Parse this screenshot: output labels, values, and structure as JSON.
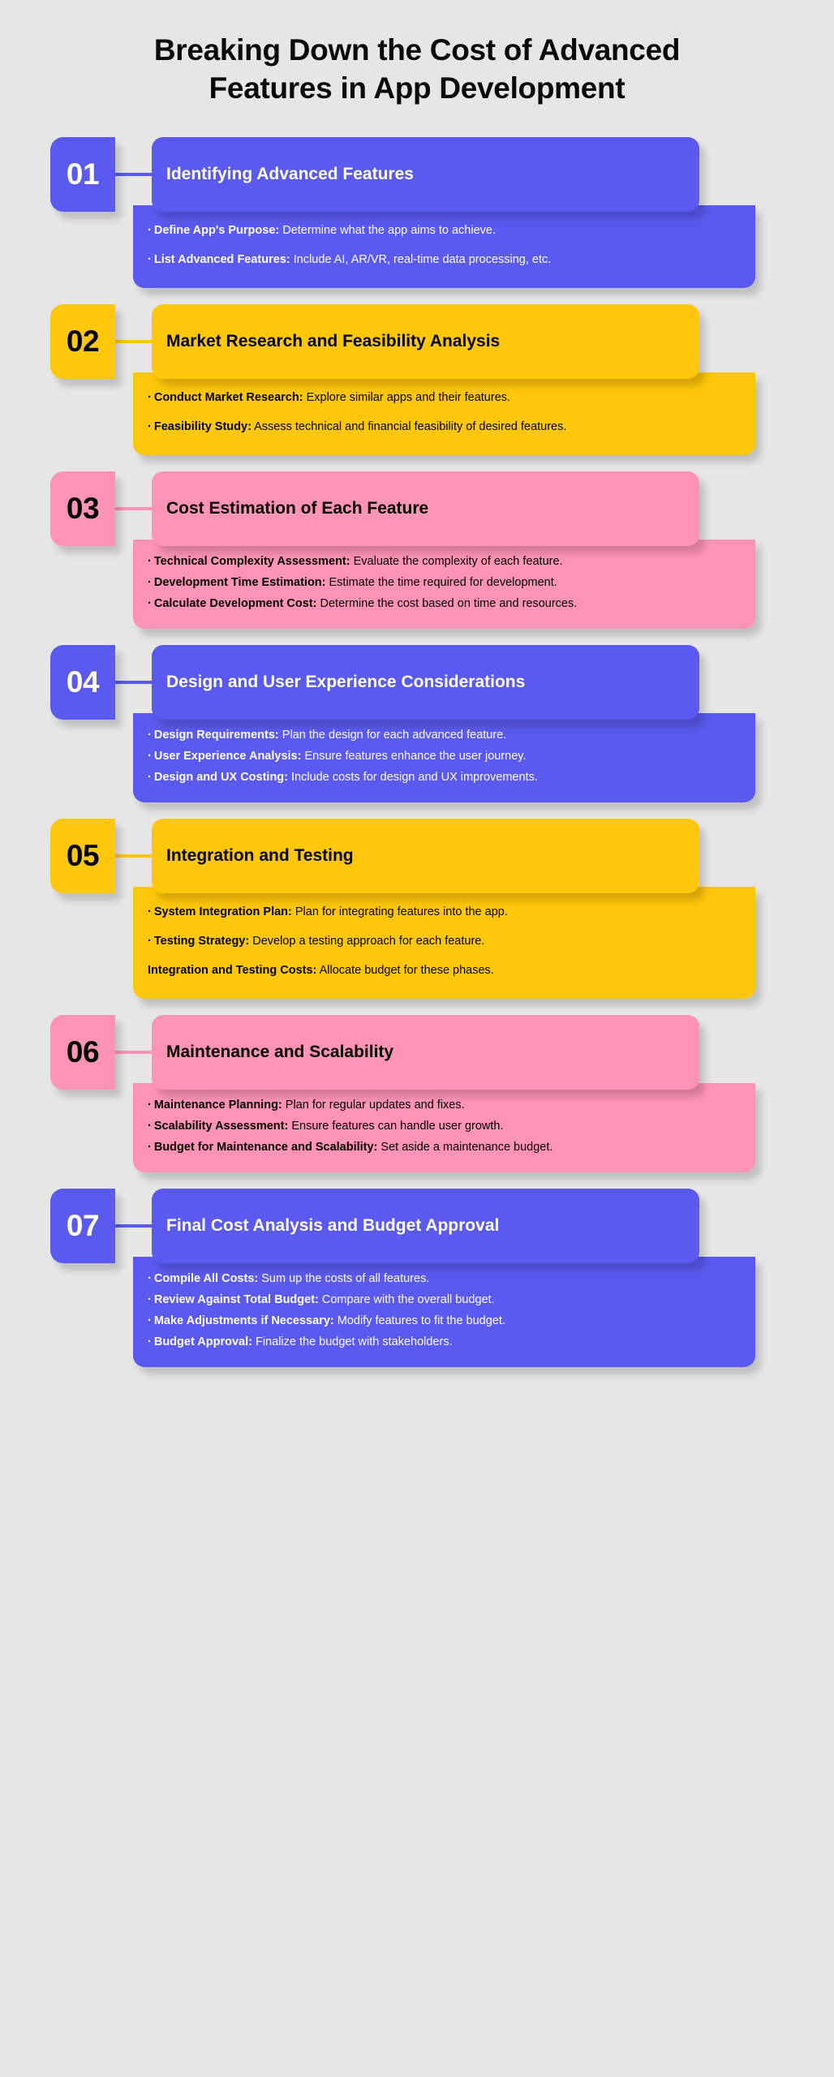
{
  "title": "Breaking Down the Cost of Advanced Features in App Development",
  "colors": {
    "background": "#e6e6e6",
    "blue": "#5a5af0",
    "yellow": "#ffc709",
    "pink": "#ff94b4",
    "title_text": "#0a0a0a"
  },
  "steps": [
    {
      "number": "01",
      "color": "blue",
      "heading": "Identifying Advanced Features",
      "bullets": [
        {
          "marker": "·",
          "lead": "Define App's Purpose:",
          "text": " Determine what the app aims to achieve."
        },
        {
          "marker": "·",
          "lead": "List Advanced Features:",
          "text": " Include AI, AR/VR, real-time data processing, etc."
        }
      ]
    },
    {
      "number": "02",
      "color": "yellow",
      "heading": "Market Research and Feasibility Analysis",
      "bullets": [
        {
          "marker": "·",
          "lead": "Conduct Market Research:",
          "text": " Explore similar apps and their features."
        },
        {
          "marker": "·",
          "lead": "Feasibility Study:",
          "text": " Assess technical and financial feasibility of desired features."
        }
      ]
    },
    {
      "number": "03",
      "color": "pink",
      "heading": "Cost Estimation of Each Feature",
      "compact": true,
      "bullets": [
        {
          "marker": "·",
          "lead": "Technical Complexity Assessment:",
          "text": " Evaluate the complexity of each feature."
        },
        {
          "marker": "·",
          "lead": "Development Time Estimation:",
          "text": " Estimate the time required for development."
        },
        {
          "marker": "·",
          "lead": "Calculate Development Cost:",
          "text": " Determine the cost based on time and resources."
        }
      ]
    },
    {
      "number": "04",
      "color": "blue",
      "heading": "Design and User Experience Considerations",
      "compact": true,
      "bullets": [
        {
          "marker": "·",
          "lead": "Design Requirements:",
          "text": " Plan the design for each advanced feature."
        },
        {
          "marker": "·",
          "lead": "User Experience Analysis:",
          "text": " Ensure features enhance the user journey."
        },
        {
          "marker": "·",
          "lead": "Design and UX Costing:",
          "text": " Include costs for design and UX improvements."
        }
      ]
    },
    {
      "number": "05",
      "color": "yellow",
      "heading": "Integration and Testing",
      "bullets": [
        {
          "marker": "·",
          "lead": "System Integration Plan:",
          "text": " Plan for integrating features into the app."
        },
        {
          "marker": "·",
          "lead": "Testing Strategy:",
          "text": " Develop a testing approach for each feature."
        },
        {
          "marker": "",
          "lead": "Integration and Testing Costs:",
          "text": " Allocate budget for these phases."
        }
      ]
    },
    {
      "number": "06",
      "color": "pink",
      "heading": "Maintenance and Scalability",
      "compact": true,
      "bullets": [
        {
          "marker": "·",
          "lead": "Maintenance Planning:",
          "text": " Plan for regular updates and fixes."
        },
        {
          "marker": "·",
          "lead": "Scalability Assessment:",
          "text": " Ensure features can handle user growth."
        },
        {
          "marker": "·",
          "lead": "Budget for Maintenance and Scalability:",
          "text": " Set aside a maintenance budget."
        }
      ]
    },
    {
      "number": "07",
      "color": "blue",
      "heading": "Final Cost Analysis and Budget Approval",
      "compact": true,
      "bullets": [
        {
          "marker": "·",
          "lead": "Compile All Costs:",
          "text": " Sum up the costs of all features."
        },
        {
          "marker": "·",
          "lead": "Review Against Total Budget:",
          "text": " Compare with the overall budget."
        },
        {
          "marker": "·",
          "lead": "Make Adjustments if Necessary:",
          "text": " Modify features to fit the budget."
        },
        {
          "marker": "·",
          "lead": "Budget Approval:",
          "text": " Finalize the budget with stakeholders."
        }
      ]
    }
  ]
}
